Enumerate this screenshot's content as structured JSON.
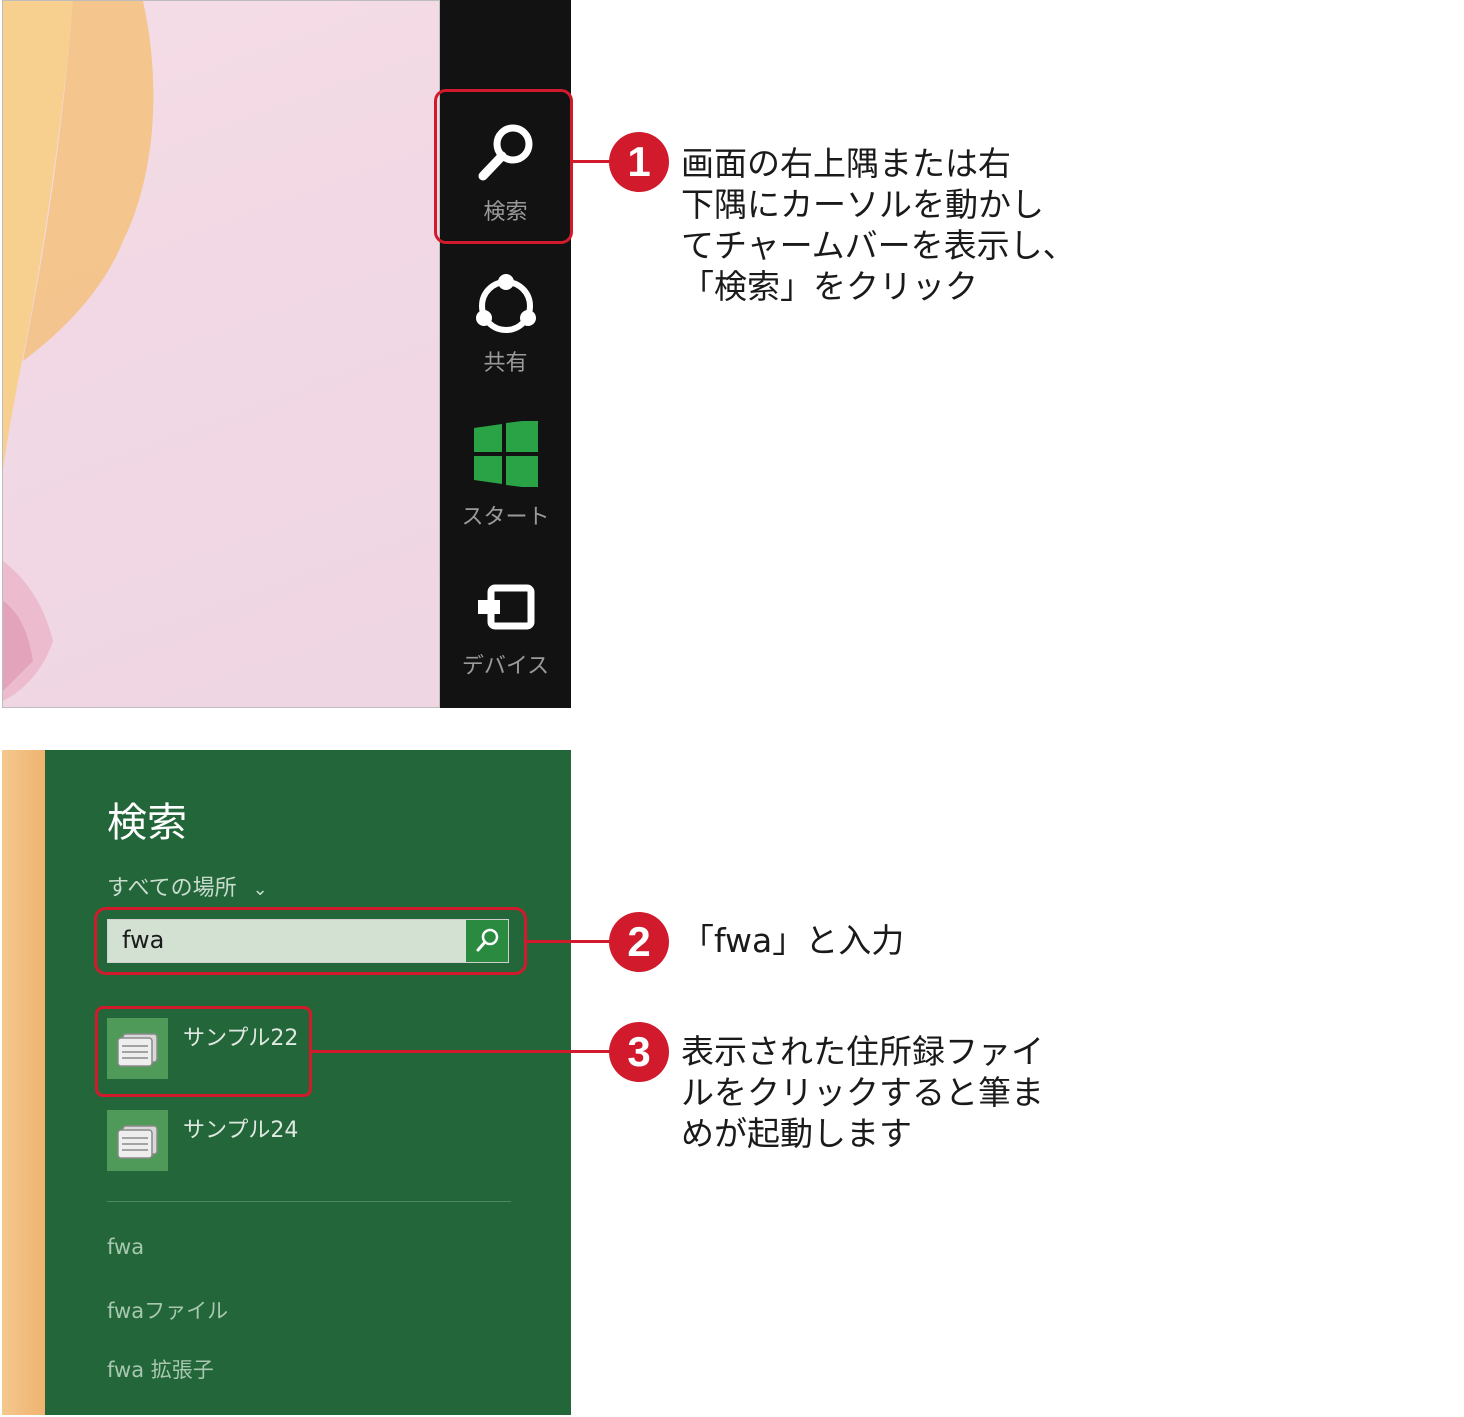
{
  "charms": {
    "search": "検索",
    "share": "共有",
    "start": "スタート",
    "devices": "デバイス"
  },
  "callouts": [
    {
      "number": "1",
      "lines": [
        "画面の右上隅または右",
        "下隅にカーソルを動かし",
        "てチャームバーを表示し、",
        "「検索」をクリック"
      ]
    },
    {
      "number": "2",
      "lines": [
        "「fwa」と入力"
      ]
    },
    {
      "number": "3",
      "lines": [
        "表示された住所録ファイ",
        "ルをクリックすると筆ま",
        "めが起動します"
      ]
    }
  ],
  "search_pane": {
    "title": "検索",
    "scope": "すべての場所",
    "query": "fwa",
    "results": [
      {
        "label": "サンプル22"
      },
      {
        "label": "サンプル24"
      }
    ],
    "suggestions": [
      "fwa",
      "fwaファイル",
      "fwa 拡張子"
    ]
  },
  "colors": {
    "accent_red": "#d11b2d",
    "charm_bg": "#121212",
    "search_pane_bg": "#236639",
    "start_icon_green": "#2aa347"
  },
  "icons": {
    "search_charm": "magnifier-icon",
    "share_charm": "share-icon",
    "start_charm": "windows-logo-icon",
    "devices_charm": "devices-icon",
    "search_button": "magnifier-icon",
    "result_file": "address-book-file-icon"
  }
}
